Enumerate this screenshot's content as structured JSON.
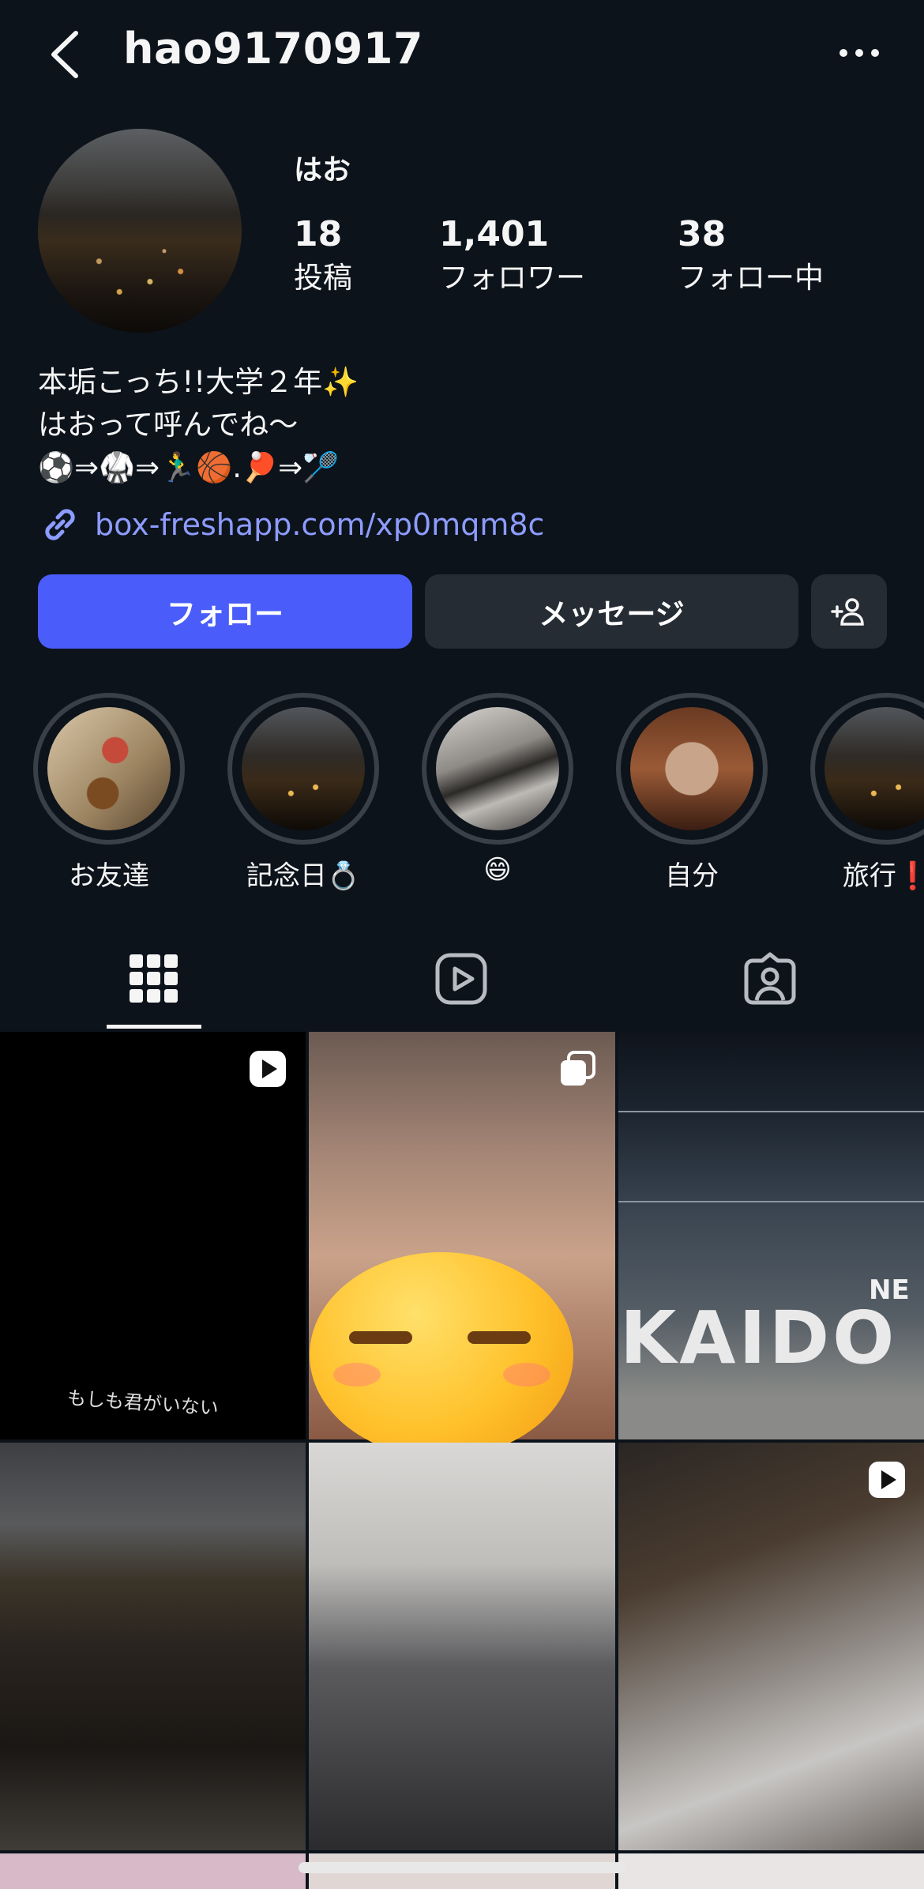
{
  "header": {
    "username": "hao9170917"
  },
  "profile": {
    "display_name": "はお",
    "stats": {
      "posts_count": "18",
      "posts_label": "投稿",
      "followers_count": "1,401",
      "followers_label": "フォロワー",
      "following_count": "38",
      "following_label": "フォロー中"
    },
    "bio": {
      "line1": "本垢こっち!!大学２年✨",
      "line2": "はおって呼んでね〜",
      "line3": "⚽⇒🥋⇒🏃‍♂️🏀.🏓⇒🏸"
    },
    "link": "box-freshapp.com/xp0mqm8c"
  },
  "actions": {
    "follow_label": "フォロー",
    "message_label": "メッセージ"
  },
  "highlights": [
    {
      "label": "お友達"
    },
    {
      "label": "記念日💍"
    },
    {
      "label": "😄"
    },
    {
      "label": "自分"
    },
    {
      "label": "旅行❗"
    }
  ],
  "posts": {
    "caption_1": "もしも君がいない",
    "sign_text": "KAIDO",
    "sign_text_2": "NE"
  },
  "icons": {
    "back": "chevron-left-icon",
    "more": "more-horizontal-icon",
    "link": "link-icon",
    "add_user": "add-user-icon",
    "grid": "grid-icon",
    "reels": "reels-icon",
    "tagged": "tagged-icon",
    "video_badge": "play-badge-icon",
    "carousel_badge": "carousel-badge-icon"
  },
  "colors": {
    "background": "#0c131b",
    "follow_button": "#4a5dfb",
    "secondary_button": "#262c34",
    "link": "#8d9cff"
  }
}
